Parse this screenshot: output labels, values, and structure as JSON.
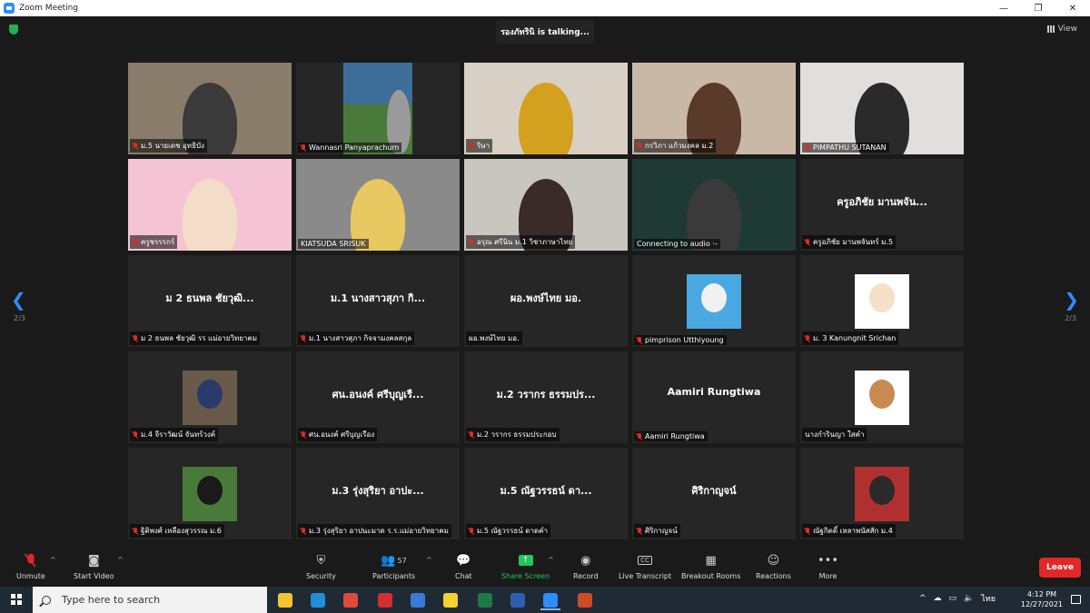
{
  "window": {
    "title": "Zoom Meeting",
    "controls": [
      "—",
      "❐",
      "✕"
    ]
  },
  "talking_indicator": "รองภัทรินิ is  talking...",
  "view_button": "View",
  "page": {
    "left": "2/3",
    "right": "2/3"
  },
  "tiles": [
    {
      "name": "ม.5 นายเดช อุทธิบัง",
      "muted": true,
      "kind": "video",
      "bg": "#8a7c6a",
      "fg": "#3a3a3a"
    },
    {
      "name": "Wannasri Panyaprachum",
      "muted": true,
      "kind": "photo",
      "bg": "#3d6e9a",
      "fg": "#4a7a3a"
    },
    {
      "name": "ริษา",
      "muted": true,
      "kind": "video",
      "bg": "#d8d0c4",
      "fg": "#d4a020"
    },
    {
      "name": "กรวิภา แก้วมงคล ม.2",
      "muted": true,
      "kind": "video",
      "bg": "#c9b8a6",
      "fg": "#5a3a2a"
    },
    {
      "name": "PIMPATHU SUTANAN",
      "muted": true,
      "kind": "video",
      "bg": "#e2dedc",
      "fg": "#2a2a2a"
    },
    {
      "name": "ครูชรรรกร์",
      "muted": true,
      "kind": "video",
      "bg": "#f4c4d4",
      "fg": "#f3dcc8"
    },
    {
      "name": "KIATSUDA SRISUK",
      "muted": false,
      "kind": "video",
      "bg": "#8a8a8a",
      "fg": "#e8c860"
    },
    {
      "name": "อรุณ  ศรีนิน ม.1 วิชาภาษาไทย",
      "muted": true,
      "kind": "video",
      "bg": "#c9c5bf",
      "fg": "#3a2a2a"
    },
    {
      "name": "Connecting to audio ·-",
      "muted": false,
      "kind": "video",
      "bg": "#1f3a34",
      "fg": "#3a3a3a"
    },
    {
      "name": "ครูอภิชัย มานพจันทร์ ม.5",
      "display": "ครูอภิชัย มานพจัน...",
      "muted": true,
      "kind": "text"
    },
    {
      "name": "ม 2 ธนพล ชัยวุฒิ รร แม่อายวิทยาคม",
      "display": "ม 2 ธนพล ชัยวุฒิ...",
      "muted": true,
      "kind": "text"
    },
    {
      "name": "ม.1 นางสาวสุภา กิจจามงคลสกุล",
      "display": "ม.1 นางสาวสุภา กิ...",
      "muted": true,
      "kind": "text"
    },
    {
      "name": "ผอ.พงษ์ไทย  มอ.",
      "display": "ผอ.พงษ์ไทย  มอ.",
      "muted": false,
      "kind": "text"
    },
    {
      "name": "pimprison Utthiyoung",
      "muted": true,
      "kind": "pic",
      "bg": "#4aa8e0",
      "fg": "#f0f0f0"
    },
    {
      "name": "ม. 3 Kanungnit Srichan",
      "muted": true,
      "kind": "pic",
      "bg": "#ffffff",
      "fg": "#f6e0c8"
    },
    {
      "name": "ม.4 จีราวัฒน์ จันทร์วงค์",
      "muted": true,
      "kind": "pic",
      "bg": "#6a5a4a",
      "fg": "#2a3a6a"
    },
    {
      "name": "ศน.อนงค์ ศรีบุญเรือง",
      "display": "ศน.อนงค์ ศรีบุญเรื...",
      "muted": true,
      "kind": "text"
    },
    {
      "name": "ม.2 วรากร ธรรมประกอบ",
      "display": "ม.2 วรากร ธรรมปร...",
      "muted": true,
      "kind": "text"
    },
    {
      "name": "Aamiri Rungtiwa",
      "display": "Aamiri Rungtiwa",
      "muted": true,
      "kind": "text"
    },
    {
      "name": "นางกำรินญา ใสคำ",
      "muted": false,
      "kind": "pic",
      "bg": "#ffffff",
      "fg": "#c88a50"
    },
    {
      "name": "ฐิติพงศ์  เหลืองสุวรรณ ม.6",
      "muted": true,
      "kind": "pic",
      "bg": "#4a7a3a",
      "fg": "#1a1a1a"
    },
    {
      "name": "ม.3 รุ่งสุริยา อาปนะมาด ร.ร.แม่อายวิทยาคม",
      "display": "ม.3 รุ่งสุริยา อาปะ...",
      "muted": true,
      "kind": "text"
    },
    {
      "name": "ม.5 ณัฐวรรธน์ ดาดคำ",
      "display": "ม.5 ณัฐวรรธน์ ดา...",
      "muted": true,
      "kind": "text"
    },
    {
      "name": "ศิริกาญจน์",
      "display": "ศิริกาญจน์",
      "muted": true,
      "kind": "text"
    },
    {
      "name": "ณัฐกิตติ์ เหลาพนัสสัก ม.4",
      "muted": true,
      "kind": "pic",
      "bg": "#b03030",
      "fg": "#2a2a2a"
    }
  ],
  "toolbar": {
    "unmute": "Unmute",
    "start_video": "Start Video",
    "security": "Security",
    "participants": "Participants",
    "participants_count": "57",
    "chat": "Chat",
    "share_screen": "Share Screen",
    "record": "Record",
    "live_transcript": "Live Transcript",
    "breakout_rooms": "Breakout Rooms",
    "reactions": "Reactions",
    "more": "More",
    "leave": "Leave"
  },
  "taskbar": {
    "search_placeholder": "Type here to search",
    "apps": [
      {
        "name": "file-explorer",
        "color": "#f4c430"
      },
      {
        "name": "edge",
        "color": "#1f8fd6"
      },
      {
        "name": "chrome",
        "color": "#e04a3a"
      },
      {
        "name": "app-red",
        "color": "#d03030"
      },
      {
        "name": "app-blue",
        "color": "#3a7ad6"
      },
      {
        "name": "sticky-notes",
        "color": "#f4d030"
      },
      {
        "name": "excel",
        "color": "#1d7a45"
      },
      {
        "name": "word",
        "color": "#2b5fb0"
      },
      {
        "name": "zoom",
        "color": "#2d8cff"
      },
      {
        "name": "powerpoint",
        "color": "#d04a26"
      }
    ],
    "tray_lang": "ไทย",
    "time": "4:12 PM",
    "date": "12/27/2021"
  }
}
